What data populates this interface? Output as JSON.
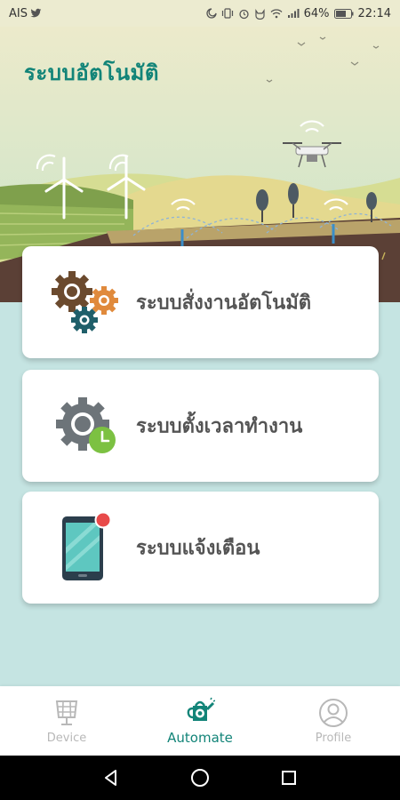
{
  "status_bar": {
    "carrier": "AIS",
    "battery": "64%",
    "time": "22:14",
    "icons": [
      "twitter-icon",
      "mute-icon",
      "vibrate-icon",
      "alarm-icon",
      "cat-icon",
      "wifi-icon",
      "signal-icon",
      "battery-icon"
    ]
  },
  "header": {
    "title": "ระบบอัตโนมัติ"
  },
  "cards": [
    {
      "label": "ระบบสั่งงานอัตโนมัติ",
      "icon": "gears-icon"
    },
    {
      "label": "ระบบตั้งเวลาทำงาน",
      "icon": "gear-clock-icon"
    },
    {
      "label": "ระบบแจ้งเตือน",
      "icon": "phone-notification-icon"
    }
  ],
  "bottom_nav": {
    "items": [
      {
        "label": "Device",
        "icon": "solar-panel-icon",
        "active": false
      },
      {
        "label": "Automate",
        "icon": "watering-can-icon",
        "active": true
      },
      {
        "label": "Profile",
        "icon": "user-icon",
        "active": false
      }
    ]
  },
  "colors": {
    "accent": "#128478",
    "card_text": "#545454",
    "inactive_nav": "#b8b8b8",
    "background": "#c5e4e2",
    "notification_dot": "#e84a4a",
    "gear_brown": "#6b4a2e",
    "gear_orange": "#e08a3c",
    "gear_teal": "#1f5f6a",
    "clock_green": "#7cc142"
  }
}
